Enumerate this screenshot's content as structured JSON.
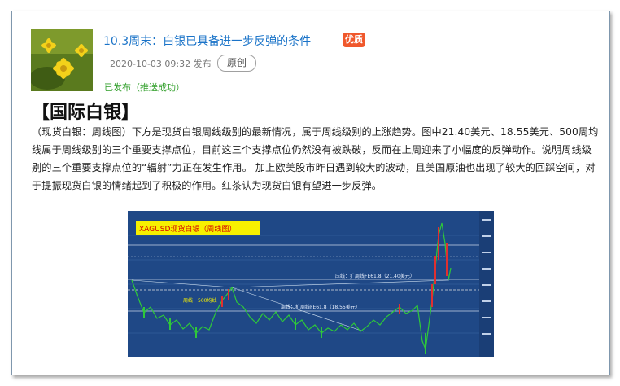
{
  "article": {
    "title": "10.3周末：白银已具备进一步反弹的条件",
    "badge": "优质",
    "datetime": "2020-10-03 09:32 发布",
    "type_label": "原创",
    "status": "已发布（推送成功）",
    "heading": "【国际白银】",
    "body": "（现货白银：周线图）下方是现货白银周线级别的最新情况，属于周线级别的上涨趋势。图中21.40美元、18.55美元、500周均线属于周线级别的三个重要支撑点位，目前这三个支撑点位仍然没有被跌破，反而在上周迎来了小幅度的反弹动作。说明周线级别的三个重要支撑点位的“辐射”力正在发生作用。 加上欧美股市昨日遇到较大的波动，且美国原油也出现了较大的回踩空间，对于提振现货白银的情绪起到了积极的作用。红茶认为现货白银有望进一步反弹。"
  },
  "chart_image": {
    "banner": "XAGUSD现货白银（周线图）",
    "label_upper": "压线：扩周线FE61.8（21.40美元）",
    "label_middle": "周线：500均线",
    "label_lower": "周线：扩周线FE61.8（18.55美元）"
  },
  "colors": {
    "title": "#1a73c8",
    "badge": "#f0582c",
    "status": "#2f9e28",
    "chart_bg": "#1f4886",
    "banner": "#f7f000"
  }
}
